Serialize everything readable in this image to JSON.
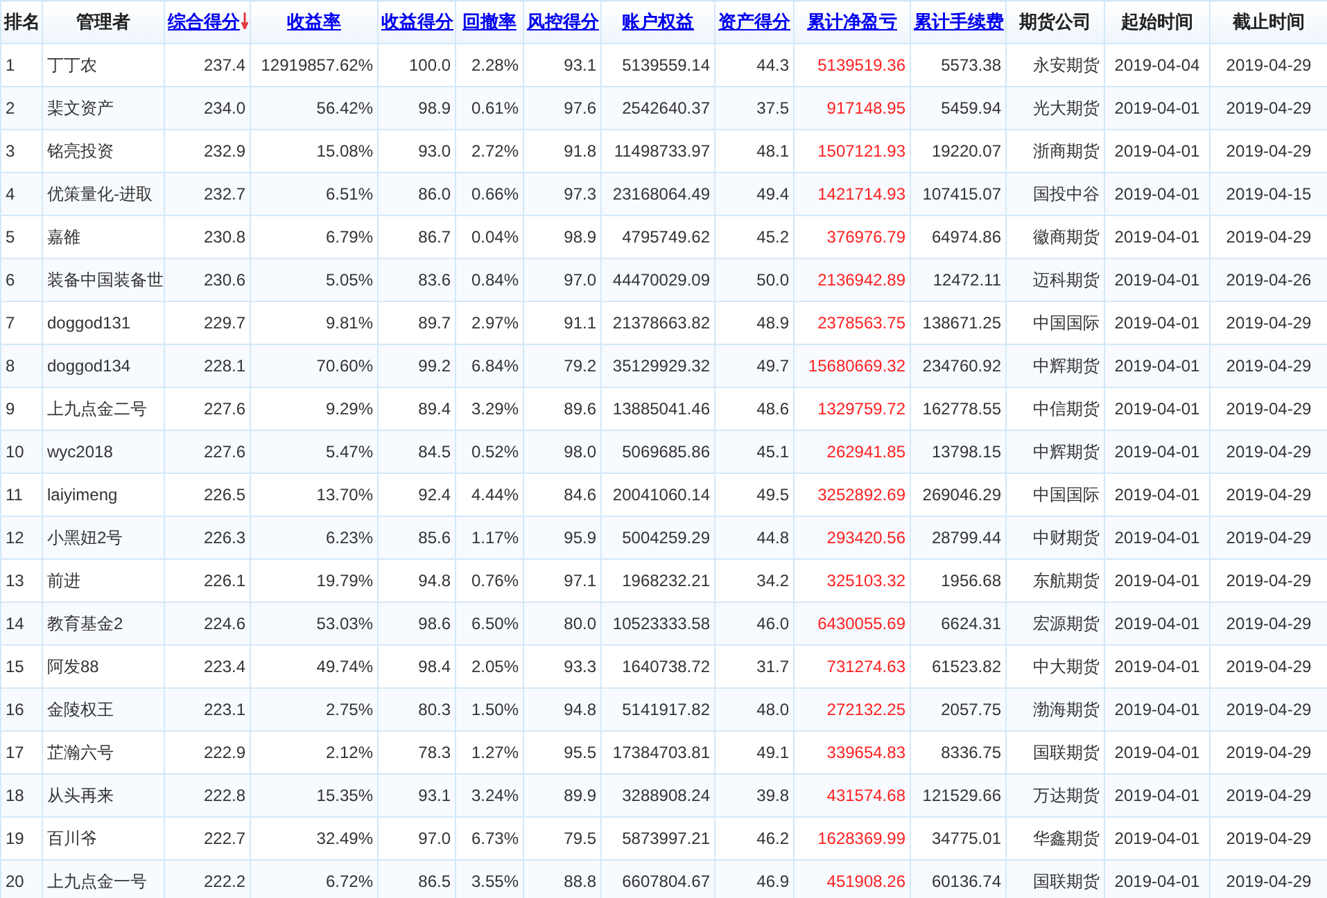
{
  "table": {
    "columns": [
      {
        "label": "排名",
        "link": false,
        "sorted": false,
        "emphasis": false
      },
      {
        "label": "管理者",
        "link": false,
        "sorted": false,
        "emphasis": false
      },
      {
        "label": "综合得分",
        "link": true,
        "sorted": true,
        "emphasis": false
      },
      {
        "label": "收益率",
        "link": true,
        "sorted": false,
        "emphasis": false
      },
      {
        "label": "收益得分",
        "link": true,
        "sorted": false,
        "emphasis": false
      },
      {
        "label": "回撤率",
        "link": true,
        "sorted": false,
        "emphasis": false
      },
      {
        "label": "风控得分",
        "link": true,
        "sorted": false,
        "emphasis": false
      },
      {
        "label": "账户权益",
        "link": true,
        "sorted": false,
        "emphasis": false
      },
      {
        "label": "资产得分",
        "link": true,
        "sorted": false,
        "emphasis": false
      },
      {
        "label": "累计净盈亏",
        "link": true,
        "sorted": false,
        "emphasis": true
      },
      {
        "label": "累计手续费",
        "link": true,
        "sorted": false,
        "emphasis": false
      },
      {
        "label": "期货公司",
        "link": false,
        "sorted": false,
        "emphasis": false
      },
      {
        "label": "起始时间",
        "link": false,
        "sorted": false,
        "emphasis": false
      },
      {
        "label": "截止时间",
        "link": false,
        "sorted": false,
        "emphasis": false
      }
    ],
    "rows": [
      [
        "1",
        "丁丁农",
        "237.4",
        "12919857.62%",
        "100.0",
        "2.28%",
        "93.1",
        "5139559.14",
        "44.3",
        "5139519.36",
        "5573.38",
        "永安期货",
        "2019-04-04",
        "2019-04-29"
      ],
      [
        "2",
        "棐文资产",
        "234.0",
        "56.42%",
        "98.9",
        "0.61%",
        "97.6",
        "2542640.37",
        "37.5",
        "917148.95",
        "5459.94",
        "光大期货",
        "2019-04-01",
        "2019-04-29"
      ],
      [
        "3",
        "铭亮投资",
        "232.9",
        "15.08%",
        "93.0",
        "2.72%",
        "91.8",
        "11498733.97",
        "48.1",
        "1507121.93",
        "19220.07",
        "浙商期货",
        "2019-04-01",
        "2019-04-29"
      ],
      [
        "4",
        "优策量化-进取",
        "232.7",
        "6.51%",
        "86.0",
        "0.66%",
        "97.3",
        "23168064.49",
        "49.4",
        "1421714.93",
        "107415.07",
        "国投中谷",
        "2019-04-01",
        "2019-04-15"
      ],
      [
        "5",
        "嘉雒",
        "230.8",
        "6.79%",
        "86.7",
        "0.04%",
        "98.9",
        "4795749.62",
        "45.2",
        "376976.79",
        "64974.86",
        "徽商期货",
        "2019-04-01",
        "2019-04-29"
      ],
      [
        "6",
        "装备中国装备世",
        "230.6",
        "5.05%",
        "83.6",
        "0.84%",
        "97.0",
        "44470029.09",
        "50.0",
        "2136942.89",
        "12472.11",
        "迈科期货",
        "2019-04-01",
        "2019-04-26"
      ],
      [
        "7",
        "doggod131",
        "229.7",
        "9.81%",
        "89.7",
        "2.97%",
        "91.1",
        "21378663.82",
        "48.9",
        "2378563.75",
        "138671.25",
        "中国国际",
        "2019-04-01",
        "2019-04-29"
      ],
      [
        "8",
        "doggod134",
        "228.1",
        "70.60%",
        "99.2",
        "6.84%",
        "79.2",
        "35129929.32",
        "49.7",
        "15680669.32",
        "234760.92",
        "中辉期货",
        "2019-04-01",
        "2019-04-29"
      ],
      [
        "9",
        "上九点金二号",
        "227.6",
        "9.29%",
        "89.4",
        "3.29%",
        "89.6",
        "13885041.46",
        "48.6",
        "1329759.72",
        "162778.55",
        "中信期货",
        "2019-04-01",
        "2019-04-29"
      ],
      [
        "10",
        "wyc2018",
        "227.6",
        "5.47%",
        "84.5",
        "0.52%",
        "98.0",
        "5069685.86",
        "45.1",
        "262941.85",
        "13798.15",
        "中辉期货",
        "2019-04-01",
        "2019-04-29"
      ],
      [
        "11",
        "laiyimeng",
        "226.5",
        "13.70%",
        "92.4",
        "4.44%",
        "84.6",
        "20041060.14",
        "49.5",
        "3252892.69",
        "269046.29",
        "中国国际",
        "2019-04-01",
        "2019-04-29"
      ],
      [
        "12",
        "小黑妞2号",
        "226.3",
        "6.23%",
        "85.6",
        "1.17%",
        "95.9",
        "5004259.29",
        "44.8",
        "293420.56",
        "28799.44",
        "中财期货",
        "2019-04-01",
        "2019-04-29"
      ],
      [
        "13",
        "前进",
        "226.1",
        "19.79%",
        "94.8",
        "0.76%",
        "97.1",
        "1968232.21",
        "34.2",
        "325103.32",
        "1956.68",
        "东航期货",
        "2019-04-01",
        "2019-04-29"
      ],
      [
        "14",
        "教育基金2",
        "224.6",
        "53.03%",
        "98.6",
        "6.50%",
        "80.0",
        "10523333.58",
        "46.0",
        "6430055.69",
        "6624.31",
        "宏源期货",
        "2019-04-01",
        "2019-04-29"
      ],
      [
        "15",
        "阿发88",
        "223.4",
        "49.74%",
        "98.4",
        "2.05%",
        "93.3",
        "1640738.72",
        "31.7",
        "731274.63",
        "61523.82",
        "中大期货",
        "2019-04-01",
        "2019-04-29"
      ],
      [
        "16",
        "金陵权王",
        "223.1",
        "2.75%",
        "80.3",
        "1.50%",
        "94.8",
        "5141917.82",
        "48.0",
        "272132.25",
        "2057.75",
        "渤海期货",
        "2019-04-01",
        "2019-04-29"
      ],
      [
        "17",
        "芷瀚六号",
        "222.9",
        "2.12%",
        "78.3",
        "1.27%",
        "95.5",
        "17384703.81",
        "49.1",
        "339654.83",
        "8336.75",
        "国联期货",
        "2019-04-01",
        "2019-04-29"
      ],
      [
        "18",
        "从头再来",
        "222.8",
        "15.35%",
        "93.1",
        "3.24%",
        "89.9",
        "3288908.24",
        "39.8",
        "431574.68",
        "121529.66",
        "万达期货",
        "2019-04-01",
        "2019-04-29"
      ],
      [
        "19",
        "百川爷",
        "222.7",
        "32.49%",
        "97.0",
        "6.73%",
        "79.5",
        "5873997.21",
        "46.2",
        "1628369.99",
        "34775.01",
        "华鑫期货",
        "2019-04-01",
        "2019-04-29"
      ],
      [
        "20",
        "上九点金一号",
        "222.2",
        "6.72%",
        "86.5",
        "3.55%",
        "88.8",
        "6607804.67",
        "46.9",
        "451908.26",
        "60136.74",
        "国联期货",
        "2019-04-01",
        "2019-04-29"
      ]
    ]
  }
}
